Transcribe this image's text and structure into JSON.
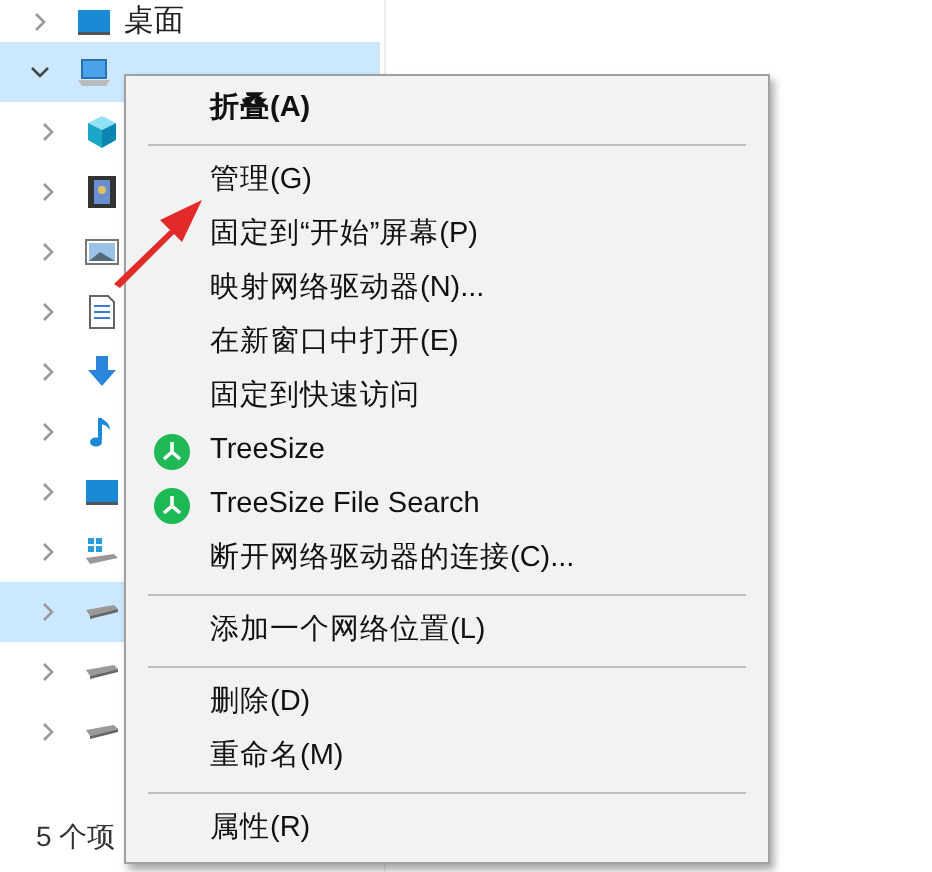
{
  "tree": [
    {
      "label": "桌面",
      "kind": "desktop-folder",
      "expanded": false,
      "selected": false
    },
    {
      "kind": "computer",
      "expanded": true,
      "selected": true,
      "children": [
        {
          "kind": "cube",
          "expanded": false,
          "selected": false
        },
        {
          "kind": "video",
          "expanded": false,
          "selected": false
        },
        {
          "kind": "pictures",
          "expanded": false,
          "selected": false
        },
        {
          "kind": "document",
          "expanded": false,
          "selected": false
        },
        {
          "kind": "download",
          "expanded": false,
          "selected": false
        },
        {
          "kind": "music",
          "expanded": false,
          "selected": false
        },
        {
          "kind": "desktop",
          "expanded": false,
          "selected": false
        },
        {
          "kind": "system-drive",
          "expanded": false,
          "selected": false
        },
        {
          "kind": "drive",
          "expanded": false,
          "selected": true
        },
        {
          "kind": "drive",
          "expanded": false,
          "selected": false
        },
        {
          "kind": "drive",
          "expanded": false,
          "selected": false
        }
      ]
    }
  ],
  "status_bar": "5 个项",
  "context_menu": [
    {
      "kind": "item",
      "label": "折叠(A)",
      "default": true
    },
    {
      "kind": "separator"
    },
    {
      "kind": "item",
      "label": "管理(G)",
      "default": false
    },
    {
      "kind": "item",
      "label": "固定到“开始”屏幕(P)",
      "default": false
    },
    {
      "kind": "item",
      "label": "映射网络驱动器(N)...",
      "default": false
    },
    {
      "kind": "item",
      "label": "在新窗口中打开(E)",
      "default": false
    },
    {
      "kind": "item",
      "label": "固定到快速访问",
      "default": false
    },
    {
      "kind": "app-item",
      "label": "TreeSize",
      "default": false
    },
    {
      "kind": "app-item",
      "label": "TreeSize File Search",
      "default": false
    },
    {
      "kind": "item",
      "label": "断开网络驱动器的连接(C)...",
      "default": false
    },
    {
      "kind": "separator"
    },
    {
      "kind": "item",
      "label": "添加一个网络位置(L)",
      "default": false
    },
    {
      "kind": "separator"
    },
    {
      "kind": "item",
      "label": "删除(D)",
      "default": false
    },
    {
      "kind": "item",
      "label": "重命名(M)",
      "default": false
    },
    {
      "kind": "separator"
    },
    {
      "kind": "item",
      "label": "属性(R)",
      "default": false
    }
  ]
}
